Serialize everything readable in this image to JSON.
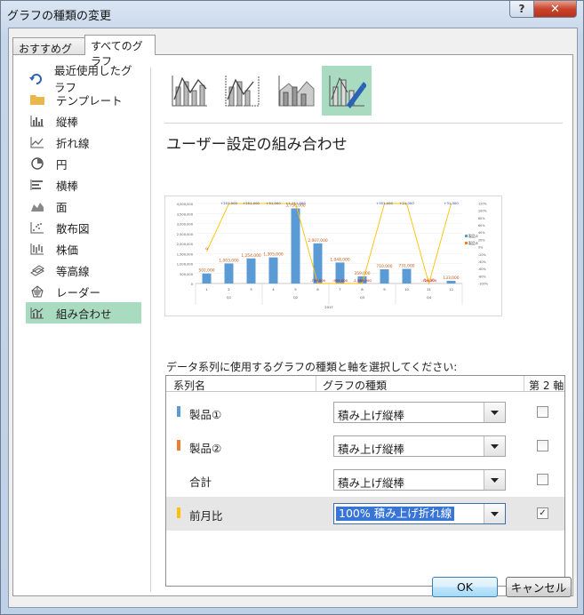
{
  "window": {
    "title": "グラフの種類の変更"
  },
  "tabs": [
    {
      "label": "おすすめグラフ"
    },
    {
      "label": "すべてのグラフ"
    }
  ],
  "sidebar": {
    "items": [
      {
        "label": "最近使用したグラフ",
        "icon": "recent-icon"
      },
      {
        "label": "テンプレート",
        "icon": "folder-icon"
      },
      {
        "label": "縦棒",
        "icon": "column-chart-icon"
      },
      {
        "label": "折れ線",
        "icon": "line-chart-icon"
      },
      {
        "label": "円",
        "icon": "pie-chart-icon"
      },
      {
        "label": "横棒",
        "icon": "bar-chart-icon"
      },
      {
        "label": "面",
        "icon": "area-chart-icon"
      },
      {
        "label": "散布図",
        "icon": "scatter-chart-icon"
      },
      {
        "label": "株価",
        "icon": "stock-chart-icon"
      },
      {
        "label": "等高線",
        "icon": "surface-chart-icon"
      },
      {
        "label": "レーダー",
        "icon": "radar-chart-icon"
      },
      {
        "label": "組み合わせ",
        "icon": "combo-chart-icon"
      }
    ],
    "selected": "組み合わせ"
  },
  "main": {
    "section_title": "ユーザー設定の組み合わせ",
    "instruction": "データ系列に使用するグラフの種類と軸を選択してください:",
    "columns": {
      "series_name": "系列名",
      "chart_type": "グラフの種類",
      "secondary_axis": "第 2 軸"
    },
    "series": [
      {
        "name": "製品①",
        "type": "積み上げ縦棒",
        "secondary": false,
        "color": "#5b9bd5"
      },
      {
        "name": "製品②",
        "type": "積み上げ縦棒",
        "secondary": false,
        "color": "#ed7d31"
      },
      {
        "name": "合計",
        "type": "積み上げ縦棒",
        "secondary": false,
        "color": ""
      },
      {
        "name": "前月比",
        "type": "100% 積み上げ折れ線",
        "secondary": true,
        "color": "#ffc000"
      }
    ]
  },
  "buttons": {
    "ok": "OK",
    "cancel": "キャンセル"
  },
  "chart_data": {
    "type": "bar",
    "categories": [
      "1",
      "2",
      "3",
      "4",
      "5",
      "6",
      "7",
      "8",
      "9",
      "10",
      "11",
      "12"
    ],
    "groups": [
      "Q1",
      "Q2",
      "Q3",
      "Q4"
    ],
    "year_label": "2017",
    "bar_labels": [
      "502,000",
      "1,003,000",
      "1,254,000",
      "1,305,000",
      "3,756,000",
      "2,007,000",
      "1,048,000",
      "359,000",
      "710,000",
      "731,000",
      "4,500",
      "133,000"
    ],
    "values": [
      502000,
      1003000,
      1254000,
      1305000,
      3756000,
      2007000,
      1048000,
      359000,
      710000,
      731000,
      4500,
      133000
    ],
    "line_labels": [
      "0",
      "+201,000",
      "+251,000",
      "+51,000",
      "+1,111,000",
      "-749,000",
      "-959,000",
      "-1,689,000",
      "+351,000",
      "+21,000",
      "-726,500",
      "+31,000"
    ],
    "line_values": [
      0.4,
      1,
      1,
      1,
      1,
      0,
      0,
      0,
      1,
      1,
      0,
      1
    ],
    "y_ticks": [
      "4,000,000",
      "3,500,000",
      "3,000,000",
      "2,500,000",
      "2,000,000",
      "1,500,000",
      "1,000,000",
      "500,000",
      "0"
    ],
    "y2_ticks": [
      "120%",
      "100%",
      "80%",
      "60%",
      "40%",
      "20%",
      "0%",
      "-20%",
      "-40%",
      "-60%",
      "-80%",
      "-100%"
    ],
    "legend": [
      "製品①",
      "製品②"
    ],
    "ylim": [
      0,
      4000000
    ]
  }
}
